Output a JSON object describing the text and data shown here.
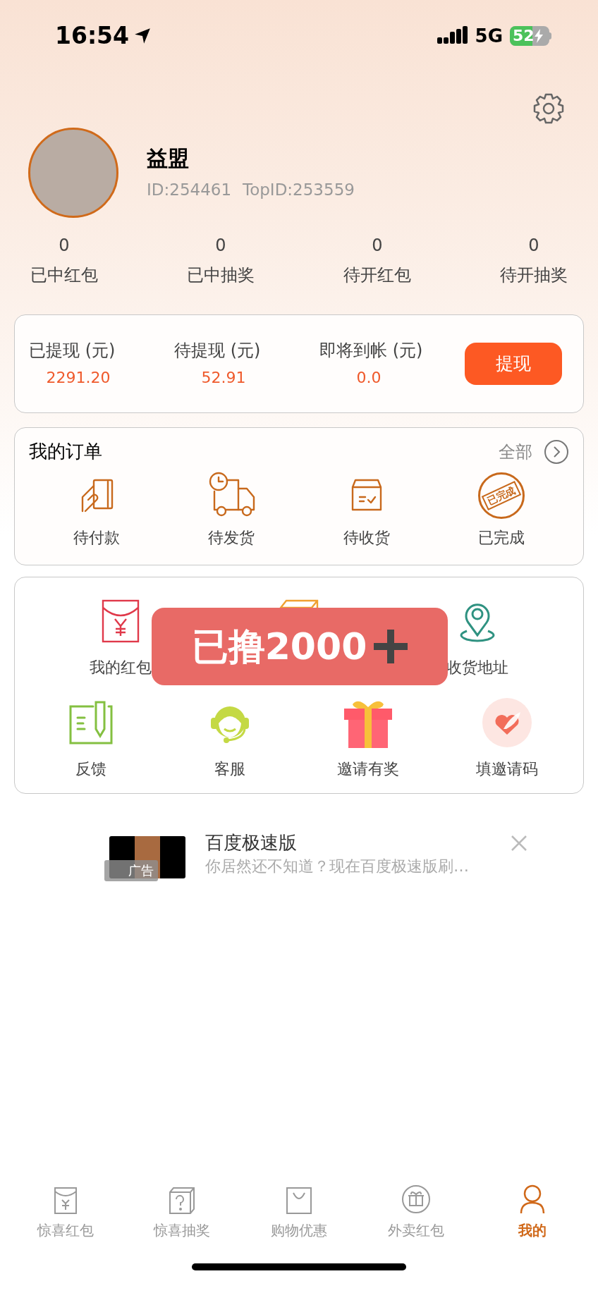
{
  "status_bar": {
    "time": "16:54",
    "network": "5G",
    "battery": "52"
  },
  "profile": {
    "name": "益盟",
    "id": "ID:254461",
    "top_id": "TopID:253559"
  },
  "stats": [
    {
      "value": "0",
      "label": "已中红包"
    },
    {
      "value": "0",
      "label": "已中抽奖"
    },
    {
      "value": "0",
      "label": "待开红包"
    },
    {
      "value": "0",
      "label": "待开抽奖"
    }
  ],
  "wallet": {
    "items": [
      {
        "label": "已提现 (元)",
        "value": "2291.20"
      },
      {
        "label": "待提现 (元)",
        "value": "52.91"
      },
      {
        "label": "即将到帐 (元)",
        "value": "0.0"
      }
    ],
    "button": "提现"
  },
  "orders": {
    "title": "我的订单",
    "all": "全部",
    "items": [
      {
        "label": "待付款",
        "kind": "pay"
      },
      {
        "label": "待发货",
        "kind": "ship"
      },
      {
        "label": "待收货",
        "kind": "receive"
      },
      {
        "label": "已完成",
        "kind": "done",
        "stamp": "已完成"
      }
    ]
  },
  "services": {
    "rows": [
      [
        {
          "label": "我的红包",
          "kind": "envelope"
        },
        {
          "kind": "mystery"
        },
        {
          "label": "收货地址",
          "kind": "location"
        }
      ],
      [
        {
          "label": "反馈",
          "kind": "feedback"
        },
        {
          "label": "客服",
          "kind": "support"
        },
        {
          "label": "邀请有奖",
          "kind": "gift"
        },
        {
          "label": "填邀请码",
          "kind": "code"
        }
      ]
    ],
    "overlay_badge": "已撸2000"
  },
  "ad": {
    "title": "百度极速版",
    "description": "你居然还不知道？现在百度极速版刷…",
    "tag": "广告"
  },
  "tabs": [
    {
      "label": "惊喜红包",
      "kind": "envelope",
      "selected": false
    },
    {
      "label": "惊喜抽奖",
      "kind": "mystery",
      "selected": false
    },
    {
      "label": "购物优惠",
      "kind": "bag",
      "selected": false
    },
    {
      "label": "外卖红包",
      "kind": "gift",
      "selected": false
    },
    {
      "label": "我的",
      "kind": "person",
      "selected": true
    }
  ]
}
